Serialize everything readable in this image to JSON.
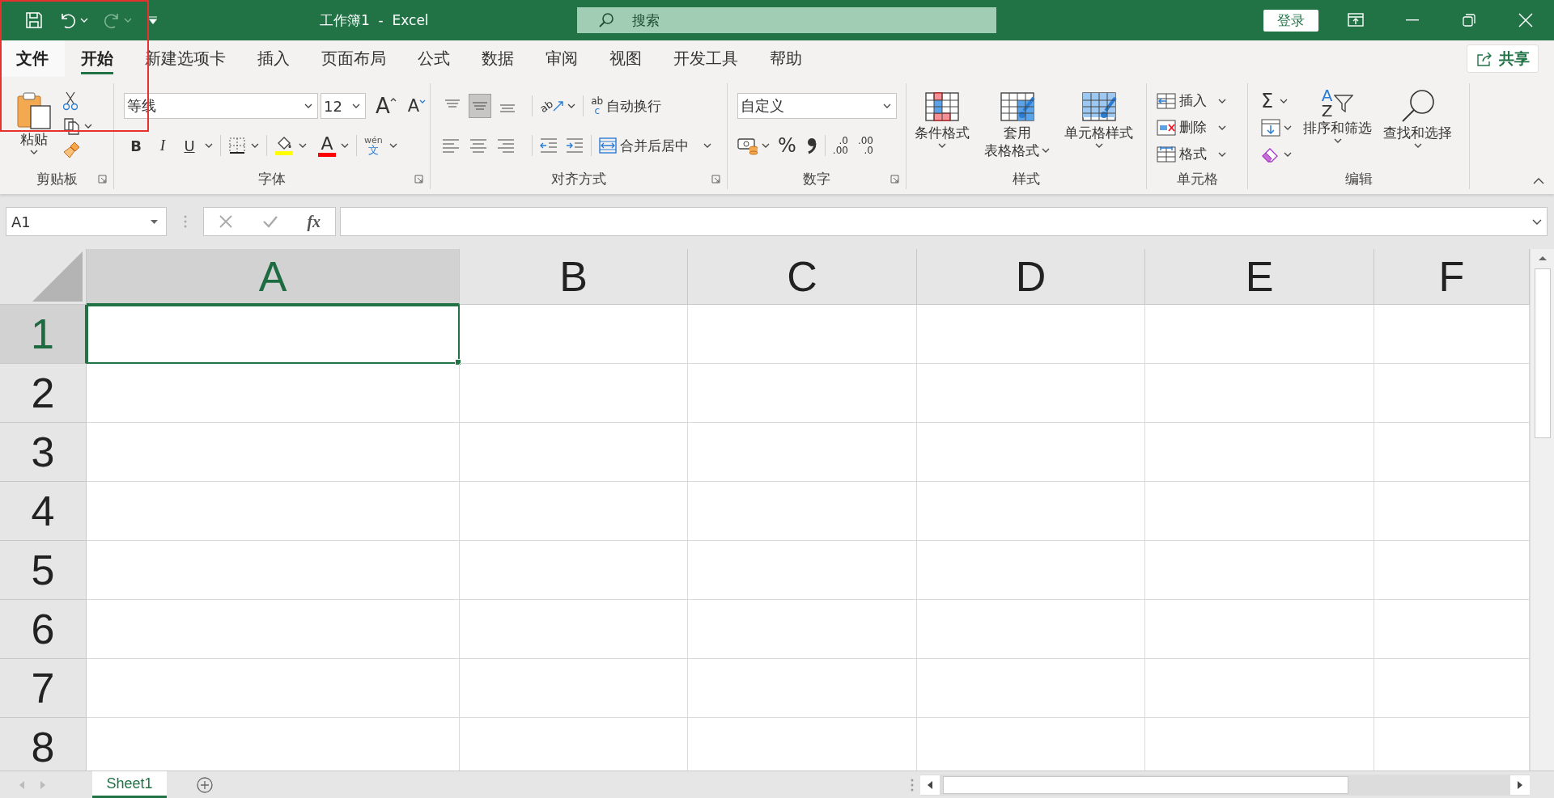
{
  "title_bar": {
    "title": "工作簿1  -  Excel",
    "search_placeholder": "搜索",
    "sign_in": "登录"
  },
  "tabs": [
    {
      "label": "文件",
      "kind": "file",
      "selected": false
    },
    {
      "label": "开始",
      "kind": "tab",
      "selected": true
    },
    {
      "label": "新建选项卡",
      "kind": "tab",
      "selected": false
    },
    {
      "label": "插入",
      "kind": "tab",
      "selected": false
    },
    {
      "label": "页面布局",
      "kind": "tab",
      "selected": false
    },
    {
      "label": "公式",
      "kind": "tab",
      "selected": false
    },
    {
      "label": "数据",
      "kind": "tab",
      "selected": false
    },
    {
      "label": "审阅",
      "kind": "tab",
      "selected": false
    },
    {
      "label": "视图",
      "kind": "tab",
      "selected": false
    },
    {
      "label": "开发工具",
      "kind": "tab",
      "selected": false
    },
    {
      "label": "帮助",
      "kind": "tab",
      "selected": false
    }
  ],
  "share": "共享",
  "ribbon": {
    "groups": [
      {
        "kind": "clipboard",
        "label": "剪贴板",
        "paste": "粘贴"
      },
      {
        "kind": "font",
        "label": "字体",
        "font_name": "等线",
        "font_size": "12",
        "grow": "A",
        "shrink": "A",
        "bold": "B",
        "italic": "I",
        "underline": "U",
        "font_color": "A",
        "phonetic_top": "wén",
        "phonetic_bottom": "文"
      },
      {
        "kind": "alignment",
        "label": "对齐方式",
        "vertical_align": [
          {
            "selected": false
          },
          {
            "selected": true
          },
          {
            "selected": false
          }
        ],
        "orientation": "ab",
        "wrap_icon": [
          "ab",
          "c"
        ],
        "wrap_text": "自动换行",
        "merge_center": "合并后居中"
      },
      {
        "kind": "number",
        "label": "数字",
        "format": "自定义",
        "percent": "%",
        "increase_decimal": [
          ".0",
          ".00"
        ],
        "decrease_decimal": [
          ".00",
          ".0"
        ]
      },
      {
        "kind": "styles",
        "label": "样式",
        "buttons": [
          {
            "kind": "conditional",
            "lines": [
              "条件格式"
            ]
          },
          {
            "kind": "table",
            "lines": [
              "套用",
              "表格格式"
            ]
          },
          {
            "kind": "cell",
            "lines": [
              "单元格样式"
            ]
          }
        ]
      },
      {
        "kind": "cells",
        "label": "单元格",
        "buttons": [
          {
            "kind": "insert",
            "label": "插入"
          },
          {
            "kind": "delete",
            "label": "删除"
          },
          {
            "kind": "format",
            "label": "格式"
          }
        ]
      },
      {
        "kind": "editing",
        "label": "编辑",
        "autosum": "Σ",
        "sort_glyphs": [
          "A",
          "Z"
        ],
        "sort": "排序和筛选",
        "find": "查找和选择"
      }
    ]
  },
  "formula_bar": {
    "name_box": "A1",
    "function_label": "fx"
  },
  "columns": [
    {
      "label": "A",
      "selected": true
    },
    {
      "label": "B",
      "selected": false
    },
    {
      "label": "C",
      "selected": false
    },
    {
      "label": "D",
      "selected": false
    },
    {
      "label": "E",
      "selected": false
    },
    {
      "label": "F",
      "selected": false
    }
  ],
  "rows": [
    {
      "label": "1",
      "selected": true
    },
    {
      "label": "2",
      "selected": false
    },
    {
      "label": "3",
      "selected": false
    },
    {
      "label": "4",
      "selected": false
    },
    {
      "label": "5",
      "selected": false
    },
    {
      "label": "6",
      "selected": false
    },
    {
      "label": "7",
      "selected": false
    },
    {
      "label": "8",
      "selected": false
    }
  ],
  "sheets": [
    {
      "label": "Sheet1",
      "selected": true
    }
  ],
  "annotations": [
    {
      "kind": "highlight"
    }
  ]
}
